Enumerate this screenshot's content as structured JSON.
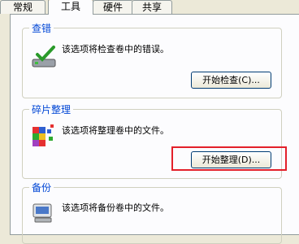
{
  "tabs": [
    "常规",
    "工具",
    "硬件",
    "共享"
  ],
  "error_check": {
    "title": "查错",
    "description": "该选项将检查卷中的错误。",
    "button_label": "开始检查(C)..."
  },
  "defrag": {
    "title": "碎片整理",
    "description": "该选项将整理卷中的文件。",
    "button_label": "开始整理(D)..."
  },
  "backup": {
    "title": "备份",
    "description": "该选项将备份卷中的文件。"
  }
}
